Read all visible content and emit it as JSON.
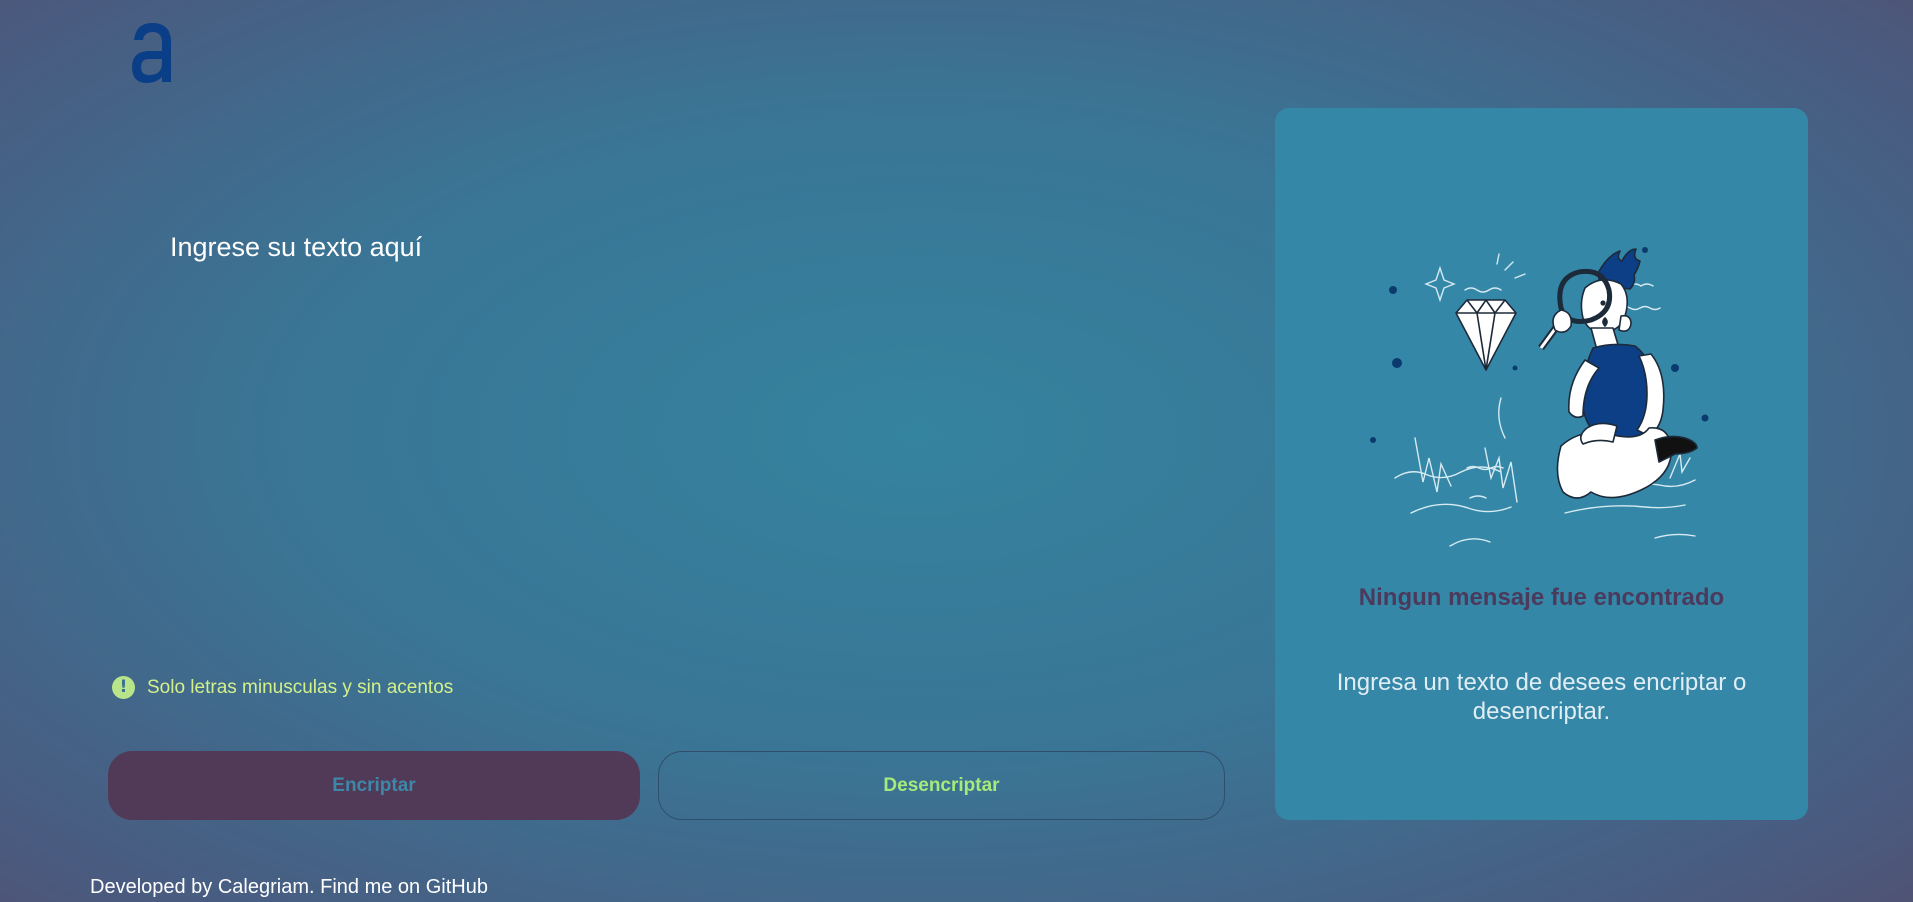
{
  "logo": {
    "letter": "a",
    "icon": "alura-logo-icon"
  },
  "input": {
    "placeholder": "Ingrese su texto aquí",
    "value": ""
  },
  "hint": {
    "icon": "exclamation-circle-icon",
    "text": "Solo letras minusculas y sin acentos"
  },
  "buttons": {
    "encrypt_label": "Encriptar",
    "decrypt_label": "Desencriptar"
  },
  "panel": {
    "illustration": "person-magnifying-glass-diamond-illustration",
    "title": "Ningun mensaje fue encontrado",
    "subtitle": "Ingresa un texto de desees encriptar o desencriptar."
  },
  "footer": {
    "text": "Developed by Calegriam. Find me on ",
    "link_label": "GitHub"
  },
  "colors": {
    "accent_green": "#a6ea7c",
    "button_dark": "#513a57",
    "panel_bg": "#3487a7",
    "logo_blue": "#0a3e86"
  }
}
